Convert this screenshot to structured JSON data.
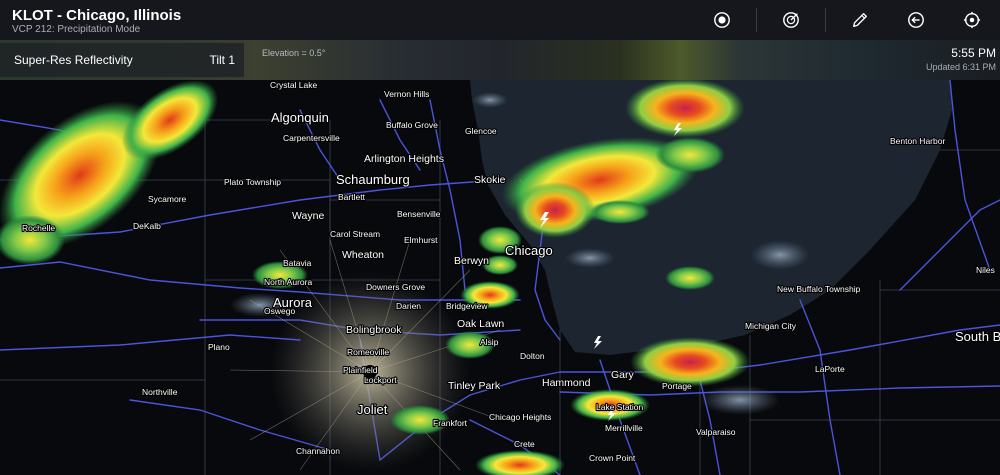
{
  "header": {
    "title": "KLOT - Chicago, Illinois",
    "subtitle": "VCP 212: Precipitation Mode"
  },
  "toolbar": {
    "buttons": [
      {
        "icon": "record-icon",
        "name": "record-button"
      },
      {
        "icon": "radar-sweep-icon",
        "name": "radar-button"
      },
      {
        "icon": "pencil-icon",
        "name": "draw-button"
      },
      {
        "icon": "arrow-circle-icon",
        "name": "navigate-button"
      },
      {
        "icon": "locate-icon",
        "name": "locate-button"
      }
    ]
  },
  "product": {
    "name": "Super-Res Reflectivity",
    "tilt": "Tilt 1",
    "elevation": "Elevation = 0.5°"
  },
  "time": {
    "current": "5:55 PM",
    "updated": "Updated 6:31 PM"
  },
  "map": {
    "water_color": "#1c2530",
    "land_color": "#08090c",
    "road_color": "#4a55d9",
    "cities": [
      {
        "name": "Crystal Lake",
        "size": "sm"
      },
      {
        "name": "Vernon Hills",
        "size": "sm"
      },
      {
        "name": "Algonquin",
        "size": "lg"
      },
      {
        "name": "Buffalo Grove",
        "size": "sm"
      },
      {
        "name": "Glencoe",
        "size": "sm"
      },
      {
        "name": "Carpentersville",
        "size": "sm"
      },
      {
        "name": "Arlington Heights",
        "size": "md"
      },
      {
        "name": "Skokie",
        "size": "md"
      },
      {
        "name": "Sycamore",
        "size": "sm"
      },
      {
        "name": "Plato Township",
        "size": "sm"
      },
      {
        "name": "Schaumburg",
        "size": "lg"
      },
      {
        "name": "Bartlett",
        "size": "sm"
      },
      {
        "name": "Wayne",
        "size": "md"
      },
      {
        "name": "Bensenville",
        "size": "sm"
      },
      {
        "name": "DeKalb",
        "size": "sm"
      },
      {
        "name": "Carol Stream",
        "size": "sm"
      },
      {
        "name": "Elmhurst",
        "size": "sm"
      },
      {
        "name": "Rochelle",
        "size": "sm"
      },
      {
        "name": "Chicago",
        "size": "lg"
      },
      {
        "name": "Wheaton",
        "size": "md"
      },
      {
        "name": "Berwyn",
        "size": "md"
      },
      {
        "name": "Batavia",
        "size": "sm"
      },
      {
        "name": "North Aurora",
        "size": "sm"
      },
      {
        "name": "Downers Grove",
        "size": "sm"
      },
      {
        "name": "Aurora",
        "size": "lg"
      },
      {
        "name": "Darien",
        "size": "sm"
      },
      {
        "name": "Bridgeview",
        "size": "sm"
      },
      {
        "name": "Oswego",
        "size": "sm"
      },
      {
        "name": "Bolingbrook",
        "size": "md"
      },
      {
        "name": "Oak Lawn",
        "size": "md"
      },
      {
        "name": "Plano",
        "size": "sm"
      },
      {
        "name": "Alsip",
        "size": "sm"
      },
      {
        "name": "Romeoville",
        "size": "sm"
      },
      {
        "name": "Dolton",
        "size": "sm"
      },
      {
        "name": "Plainfield",
        "size": "sm"
      },
      {
        "name": "Lockport",
        "size": "sm"
      },
      {
        "name": "Tinley Park",
        "size": "md"
      },
      {
        "name": "Hammond",
        "size": "md"
      },
      {
        "name": "Northville",
        "size": "sm"
      },
      {
        "name": "Joliet",
        "size": "lg"
      },
      {
        "name": "Chicago Heights",
        "size": "sm"
      },
      {
        "name": "Frankfort",
        "size": "sm"
      },
      {
        "name": "Gary",
        "size": "md"
      },
      {
        "name": "Portage",
        "size": "sm"
      },
      {
        "name": "Crete",
        "size": "sm"
      },
      {
        "name": "Merrillville",
        "size": "sm"
      },
      {
        "name": "Channahon",
        "size": "sm"
      },
      {
        "name": "Crown Point",
        "size": "sm"
      },
      {
        "name": "Valparaiso",
        "size": "sm"
      },
      {
        "name": "Benton Harbor",
        "size": "sm"
      },
      {
        "name": "Niles",
        "size": "sm"
      },
      {
        "name": "New Buffalo Township",
        "size": "sm"
      },
      {
        "name": "Michigan City",
        "size": "sm"
      },
      {
        "name": "LaPorte",
        "size": "sm"
      },
      {
        "name": "South Be",
        "size": "lg"
      },
      {
        "name": "Lake Station",
        "size": "sm"
      }
    ]
  }
}
